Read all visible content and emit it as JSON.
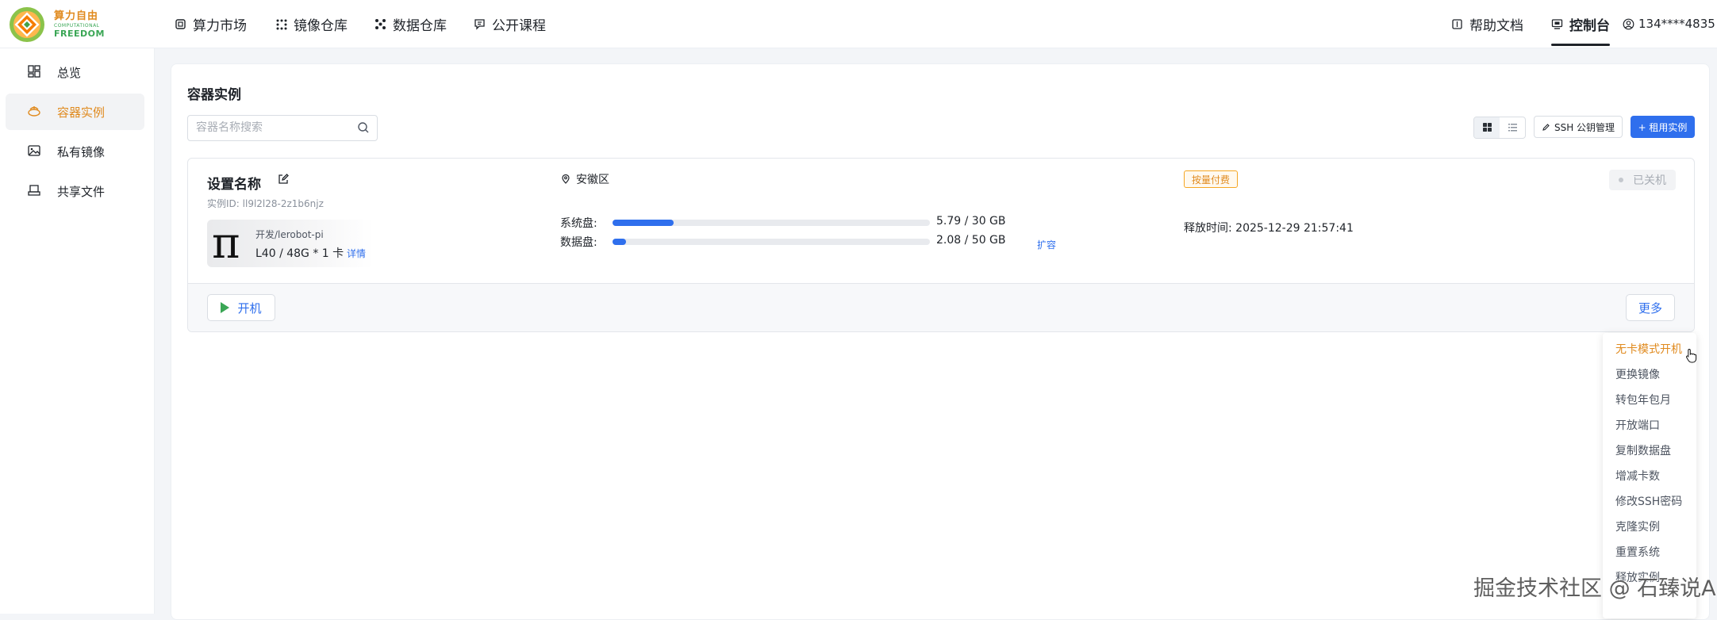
{
  "brand": {
    "name_cn": "算力自由",
    "name_en_line1": "COMPUTATIONAL",
    "name_en_line2": "FREEDOM"
  },
  "topnav": {
    "items": [
      {
        "label": "算力市场",
        "icon": "chip-icon"
      },
      {
        "label": "镜像仓库",
        "icon": "image-repo-icon"
      },
      {
        "label": "数据仓库",
        "icon": "data-repo-icon"
      },
      {
        "label": "公开课程",
        "icon": "course-icon"
      }
    ],
    "help_docs": "帮助文档",
    "console": "控制台",
    "user": "134****4835"
  },
  "sidebar": {
    "items": [
      {
        "label": "总览",
        "icon": "dashboard-icon",
        "active": false
      },
      {
        "label": "容器实例",
        "icon": "container-icon",
        "active": true
      },
      {
        "label": "私有镜像",
        "icon": "private-image-icon",
        "active": false
      },
      {
        "label": "共享文件",
        "icon": "shared-files-icon",
        "active": false
      }
    ]
  },
  "main": {
    "title": "容器实例",
    "search_placeholder": "容器名称搜索",
    "ssh_button": "SSH 公钥管理",
    "rent_button": "+ 租用实例"
  },
  "instance": {
    "name": "设置名称",
    "id_label": "实例ID:",
    "id": "ll9l2l28-2z1b6njz",
    "image_name": "开发/lerobot-pi",
    "gpu_spec": "L40 / 48G  *  1 卡",
    "detail_link": "详情",
    "region": "安徽区",
    "system_disk_label": "系统盘:",
    "system_disk_value": "5.79 / 30 GB",
    "system_disk_used_fraction": 0.193,
    "data_disk_label": "数据盘:",
    "data_disk_value": "2.08 / 50 GB",
    "data_disk_used_fraction": 0.042,
    "expand_link": "扩容",
    "billing_tag": "按量付费",
    "release_time_label": "释放时间:",
    "release_time": "2025-12-29 21:57:41",
    "status": "已关机",
    "start_button": "开机",
    "more_button": "更多"
  },
  "more_menu": {
    "items": [
      "无卡模式开机",
      "更换镜像",
      "转包年包月",
      "开放端口",
      "复制数据盘",
      "增减卡数",
      "修改SSH密码",
      "克隆实例",
      "重置系统",
      "释放实例"
    ]
  },
  "watermark": "掘金技术社区 @ 石臻说AI",
  "colors": {
    "accent_orange": "#e08a1e",
    "primary_blue": "#2f6fed",
    "brand_green": "#3aa655"
  }
}
